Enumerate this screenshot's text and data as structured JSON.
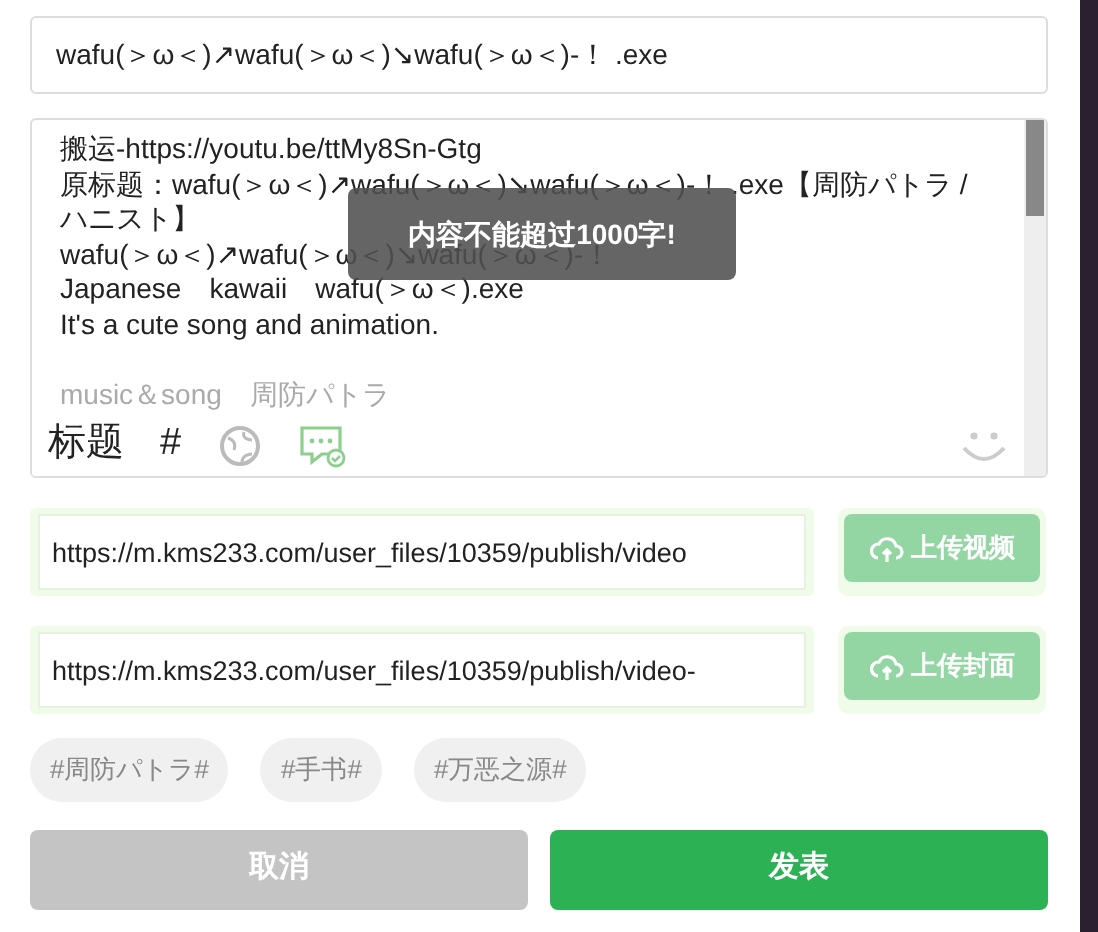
{
  "title_field": {
    "value": "wafu(＞ω＜)↗wafu(＞ω＜)↘wafu(＞ω＜)-！ .exe"
  },
  "content_field": {
    "paragraphs": [
      [
        "搬运-https://youtu.be/ttMy8Sn-Gtg",
        "原标题：wafu(＞ω＜)↗wafu(＞ω＜)↘wafu(＞ω＜)-！ .exe【周防パトラ /",
        "ハニスト】",
        "wafu(＞ω＜)↗wafu(＞ω＜)↘wafu(＞ω＜)-！",
        "Japanese　kawaii　wafu(＞ω＜).exe",
        "It's a cute song and animation."
      ],
      [
        "music＆song　周防パトラ"
      ]
    ]
  },
  "toast": "内容不能超过1000字!",
  "toolbar": {
    "title_label": "标题",
    "hash_label": "#"
  },
  "uploads": [
    {
      "value": "https://m.kms233.com/user_files/10359/publish/video",
      "button": "上传视频"
    },
    {
      "value": "https://m.kms233.com/user_files/10359/publish/video-",
      "button": "上传封面"
    }
  ],
  "tags": [
    "#周防パトラ#",
    "#手书#",
    "#万恶之源#"
  ],
  "buttons": [
    {
      "kind": "cancel",
      "label": "取消"
    },
    {
      "kind": "submit",
      "label": "发表"
    }
  ]
}
